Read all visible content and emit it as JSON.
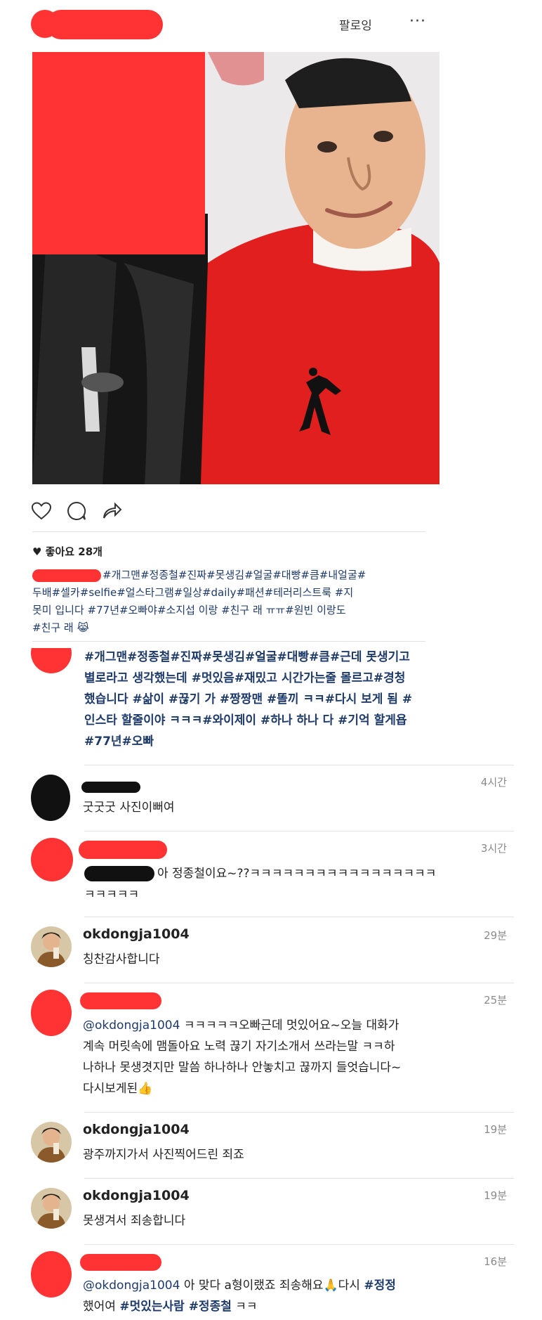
{
  "header": {
    "follow_label": "팔로잉",
    "more_label": "···"
  },
  "post": {
    "likes_label": "♥ 좋아요 28개",
    "caption_line1": "#개그맨#정종철#진짜#못생김#얼굴#대빵#큼#내얼굴#",
    "caption_line2": "두배#셀카#selfie#얼스타그램#일상#daily#패션#테러리스트룩 #지",
    "caption_line3": "못미 입니다 #77년#오빠야#소지섭 이랑 #친구 래 ㅠㅠ#원빈 이랑도",
    "caption_line4": "#친구 래 😹"
  },
  "comments": [
    {
      "id": "c1",
      "text_line1": "#개그맨#정종철#진짜#못생김#얼굴#대빵#큼#근데 못생기고",
      "text_line2": "별로라고 생각했는데 #멋있음#재밌고 시간가는줄 몰르고#경청",
      "text_line3": "했습니다 #삶이 #끊기 가 #짱짱맨 #똘끼 ㅋㅋ#다시 보게 됨 #",
      "text_line4": "인스타 할줄이야 ㅋㅋㅋ#와이제이 #하나 하나 다 #기억 할게욥",
      "text_line5": "#77년#오빠"
    },
    {
      "id": "c2",
      "time": "4시간",
      "text": "굿굿굿 사진이뻐여"
    },
    {
      "id": "c3",
      "time": "3시간",
      "text_line1": "아 정종철이요~??ㅋㅋㅋㅋㅋㅋㅋㅋㅋㅋㅋㅋㅋㅋㅋㅋㅋ",
      "text_line2": "ㅋㅋㅋㅋㅋ"
    },
    {
      "id": "c4",
      "username": "okdongja1004",
      "time": "29분",
      "text": "칭찬감사합니다"
    },
    {
      "id": "c5",
      "time": "25분",
      "mention": "@okdongja1004",
      "text_line1": " ㅋㅋㅋㅋㅋ오빠근데 멋있어요~오늘 대화가",
      "text_line2": "계속 머릿속에 맴돌아요 노력 끊기 자기소개서 쓰라는말 ㅋㅋ하",
      "text_line3": "나하나 못생겻지만 말씀 하나하나 안놓치고 끊까지 들엇습니다~",
      "text_line4": "다시보게된👍"
    },
    {
      "id": "c6",
      "username": "okdongja1004",
      "time": "19분",
      "text": "광주까지가서 사진찍어드린 죄죠"
    },
    {
      "id": "c7",
      "username": "okdongja1004",
      "time": "19분",
      "text": "못생겨서 죄송합니다"
    },
    {
      "id": "c8",
      "time": "16분",
      "mention": "@okdongja1004",
      "text_line1a": " 아 맞다 a형이랬죠 죄송해요🙏다시 ",
      "hash1": "#정정",
      "text_line2a": "했어여 ",
      "hash2": "#멋있는사람 #정종철",
      "text_line2b": " ㅋㅋ"
    }
  ],
  "colors": {
    "redaction": "#ff3333",
    "hashtag": "#1f3b6b",
    "time": "#8a8a8a"
  }
}
